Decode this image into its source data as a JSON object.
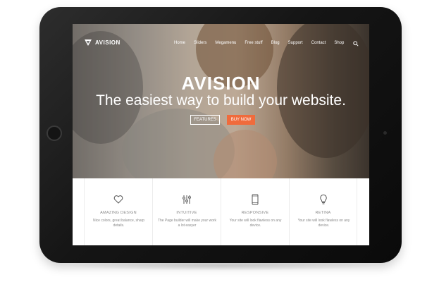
{
  "brand": {
    "name": "AVISION"
  },
  "nav": {
    "items": [
      "Home",
      "Sliders",
      "Megamenu",
      "Free stuff",
      "Blog",
      "Support",
      "Contact",
      "Shop"
    ]
  },
  "hero": {
    "title": "AVISION",
    "subtitle": "The easiest way to build your website.",
    "features_button": "FEATURES",
    "buy_button": "BUY NOW"
  },
  "features": [
    {
      "icon": "heart-icon",
      "title": "AMAZING DESIGN",
      "desc": "Nice colors, great balance, sharp details."
    },
    {
      "icon": "sliders-icon",
      "title": "INTUITIVE",
      "desc": "The Page builder will make your work a lot easyer"
    },
    {
      "icon": "phone-icon",
      "title": "RESPONSIVE",
      "desc": "Your site will look flawless on any device."
    },
    {
      "icon": "bulb-icon",
      "title": "RETINA",
      "desc": "Your site will look flawless on any device."
    }
  ],
  "colors": {
    "accent": "#f06b3c",
    "bezel": "#1a1a1a"
  }
}
